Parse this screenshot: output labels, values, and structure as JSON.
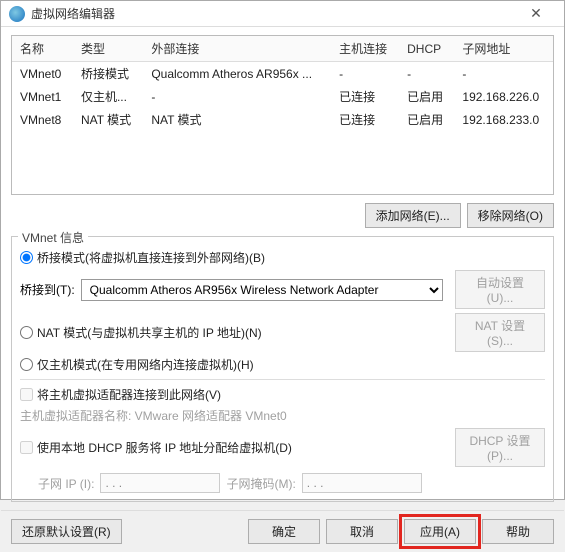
{
  "window": {
    "title": "虚拟网络编辑器"
  },
  "table": {
    "headers": {
      "name": "名称",
      "type": "类型",
      "ext": "外部连接",
      "host": "主机连接",
      "dhcp": "DHCP",
      "subnet": "子网地址"
    },
    "rows": [
      {
        "name": "VMnet0",
        "type": "桥接模式",
        "ext": "Qualcomm Atheros AR956x ...",
        "host": "-",
        "dhcp": "-",
        "subnet": "-"
      },
      {
        "name": "VMnet1",
        "type": "仅主机...",
        "ext": "-",
        "host": "已连接",
        "dhcp": "已启用",
        "subnet": "192.168.226.0"
      },
      {
        "name": "VMnet8",
        "type": "NAT 模式",
        "ext": "NAT 模式",
        "host": "已连接",
        "dhcp": "已启用",
        "subnet": "192.168.233.0"
      }
    ]
  },
  "net_actions": {
    "add": "添加网络(E)...",
    "remove": "移除网络(O)"
  },
  "info": {
    "title": "VMnet 信息",
    "bridge_radio": "桥接模式(将虚拟机直接连接到外部网络)(B)",
    "bridge_to_label": "桥接到(T):",
    "bridge_adapter": "Qualcomm Atheros AR956x Wireless Network Adapter",
    "auto_btn": "自动设置(U)...",
    "nat_radio": "NAT 模式(与虚拟机共享主机的 IP 地址)(N)",
    "nat_btn": "NAT 设置(S)...",
    "hostonly_radio": "仅主机模式(在专用网络内连接虚拟机)(H)",
    "connect_host_chk": "将主机虚拟适配器连接到此网络(V)",
    "host_adapter_label": "主机虚拟适配器名称: VMware 网络适配器 VMnet0",
    "dhcp_chk": "使用本地 DHCP 服务将 IP 地址分配给虚拟机(D)",
    "dhcp_btn": "DHCP 设置(P)...",
    "subnet_ip_label": "子网 IP (I):",
    "subnet_mask_label": "子网掩码(M):",
    "subnet_ip": ". . .",
    "subnet_mask": ". . ."
  },
  "footer": {
    "restore": "还原默认设置(R)",
    "ok": "确定",
    "cancel": "取消",
    "apply": "应用(A)",
    "help": "帮助"
  }
}
